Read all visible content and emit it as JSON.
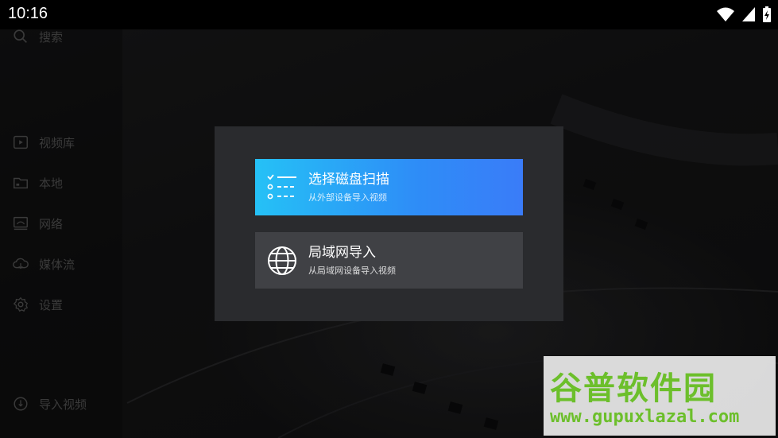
{
  "status_bar": {
    "time": "10:16"
  },
  "sidebar": {
    "search_label": "搜索",
    "items": [
      {
        "label": "视频库",
        "icon": "video-library-icon"
      },
      {
        "label": "本地",
        "icon": "folder-icon"
      },
      {
        "label": "网络",
        "icon": "network-drive-icon"
      },
      {
        "label": "媒体流",
        "icon": "cloud-stream-icon"
      },
      {
        "label": "设置",
        "icon": "gear-icon"
      }
    ],
    "import_label": "导入视频"
  },
  "dialog": {
    "options": [
      {
        "title": "选择磁盘扫描",
        "subtitle": "从外部设备导入视频",
        "icon": "checklist-icon"
      },
      {
        "title": "局域网导入",
        "subtitle": "从局域网设备导入视频",
        "icon": "globe-icon"
      }
    ]
  },
  "watermark": {
    "title": "谷普软件园",
    "url": "www.gupuxlazal.com"
  },
  "colors": {
    "accent_start": "#25c1f6",
    "accent_end": "#3a7cf8",
    "watermark_green": "#6cbf2b"
  }
}
